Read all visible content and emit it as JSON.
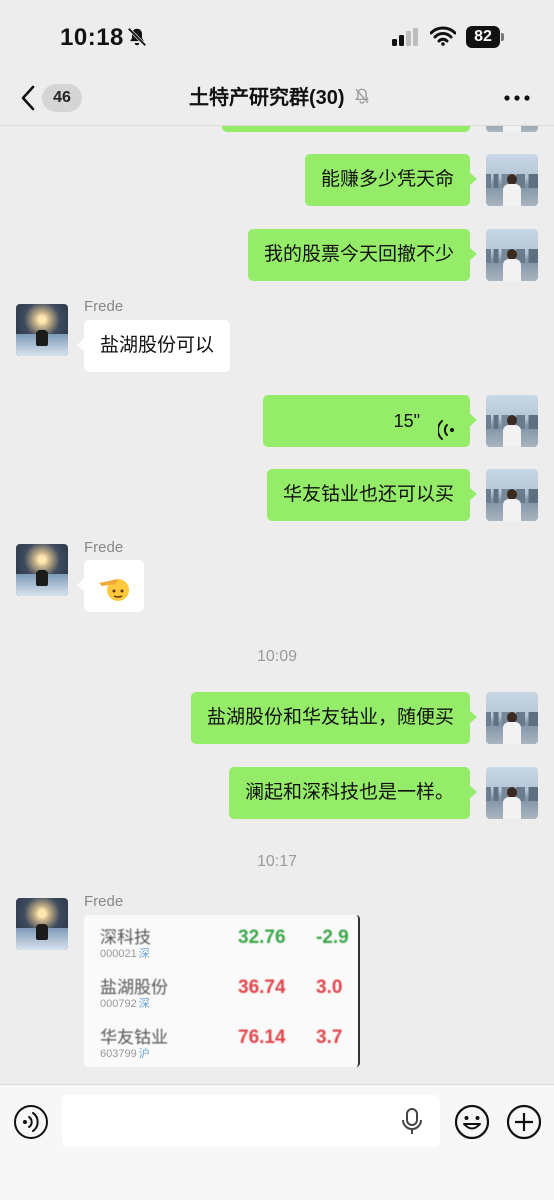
{
  "status_bar": {
    "time": "10:18",
    "battery": "82"
  },
  "nav": {
    "unread_count": "46",
    "title": "土特产研究群(30)"
  },
  "messages": {
    "m1": "能赚多少凭天命",
    "m2": "我的股票今天回撤不少",
    "m3_sender": "Frede",
    "m3": "盐湖股份可以",
    "m4_voice": "15\"",
    "m5": "华友钴业也还可以买",
    "m6_sender": "Frede",
    "m6": "🫡",
    "time1": "10:09",
    "m7": "盐湖股份和华友钴业，随便买",
    "m8": "澜起和深科技也是一样。",
    "time2": "10:17",
    "m9_sender": "Frede"
  },
  "stock_table": {
    "rows": [
      {
        "name": "深科技",
        "code": "000021",
        "tag": "深",
        "price": "32.76",
        "change": "-2.9",
        "color": "#3aa64a"
      },
      {
        "name": "盐湖股份",
        "code": "000792",
        "tag": "深",
        "price": "36.74",
        "change": "3.0",
        "color": "#e0454a"
      },
      {
        "name": "华友钴业",
        "code": "603799",
        "tag": "沪",
        "price": "76.14",
        "change": "3.7",
        "color": "#e0454a"
      }
    ]
  },
  "colors": {
    "outgoing_bubble": "#95ec69",
    "incoming_bubble": "#ffffff",
    "background": "#ededed"
  },
  "input": {
    "placeholder": ""
  }
}
